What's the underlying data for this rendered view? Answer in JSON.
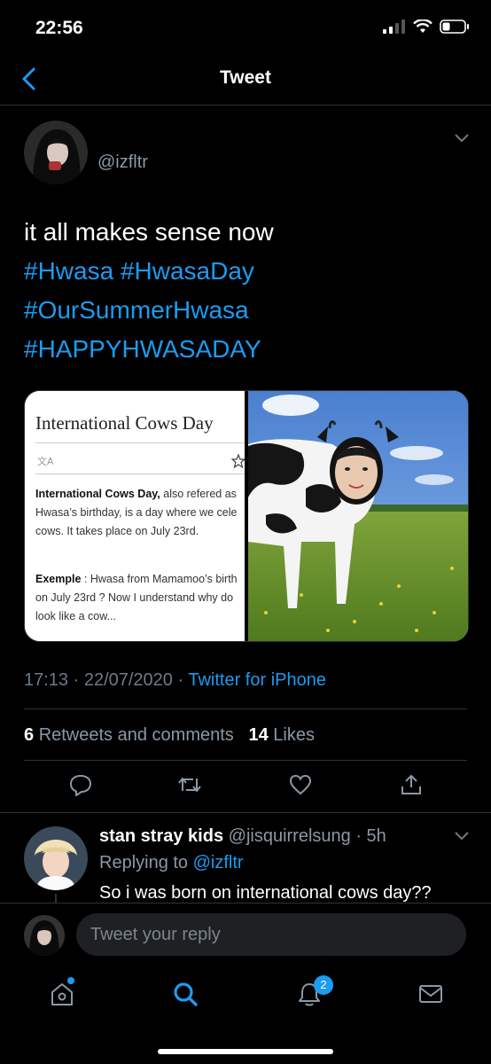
{
  "status": {
    "time": "22:56"
  },
  "header": {
    "title": "Tweet"
  },
  "tweet": {
    "handle": "@izfltr",
    "text_line1": "it all makes sense now",
    "tags_line2": "#Hwasa #HwasaDay",
    "tags_line3": "#OurSummerHwasa",
    "tags_line4": "#HAPPYHWASADAY",
    "time": "17:13 · 22/07/2020 · ",
    "source": "Twitter for iPhone",
    "retweets_count": "6",
    "retweets_label": "Retweets and comments",
    "likes_count": "14",
    "likes_label": "Likes"
  },
  "media": {
    "wiki_title": "International Cows Day",
    "p1_bold": "International Cows Day,",
    "p1_rest": " also refered as",
    "p1_line2": "Hwasa’s birthday, is a day where we cele",
    "p1_line3": "cows. It takes place on July 23rd.",
    "p2_bold": "Exemple",
    "p2_rest": " : Hwasa from Mamamoo’s birth",
    "p2_line2": "on July 23rd ? Now I understand why do",
    "p2_line3": "look like a cow..."
  },
  "reply": {
    "name": "stan stray kids",
    "handle_time": " @jisquirrelsung · 5h",
    "replying_prefix": "Replying to ",
    "replying_to": "@izfltr",
    "text": "So i was born on international cows day??"
  },
  "compose": {
    "placeholder": "Tweet your reply"
  },
  "tabbar": {
    "notifications_badge": "2"
  },
  "colors": {
    "accent": "#1d9bf0",
    "background": "#000000",
    "muted": "#8b98a5"
  }
}
